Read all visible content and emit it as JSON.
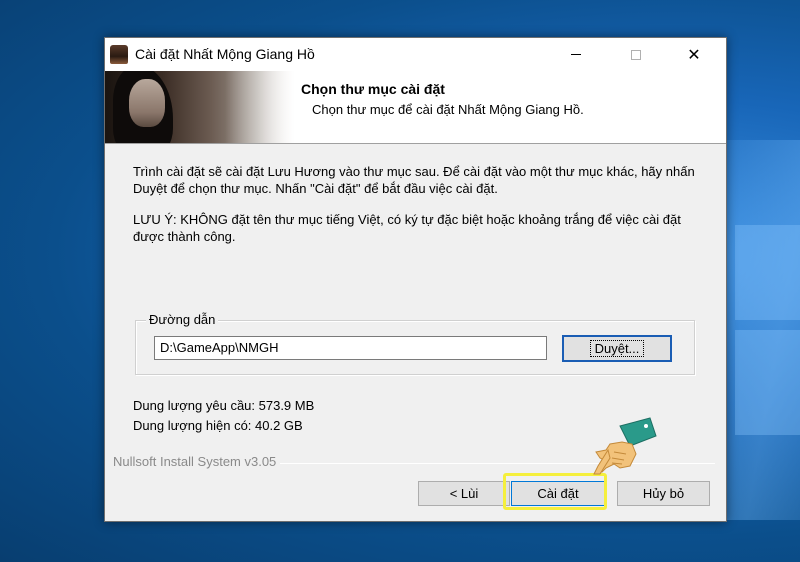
{
  "window": {
    "title": "Cài đặt Nhất Mộng Giang Hồ",
    "minimize_glyph": "",
    "close_glyph": "✕"
  },
  "header": {
    "title": "Chọn thư mục cài đặt",
    "subtitle": "Chọn thư mục để cài đặt Nhất Mộng Giang Hồ."
  },
  "body": {
    "paragraph1": "Trình cài đặt sẽ cài đặt Lưu Hương vào thư mục sau. Để cài đặt vào một thư mục khác, hãy nhấn Duyệt để chọn thư mục. Nhấn \"Cài đặt\" để bắt đầu việc cài đặt.",
    "paragraph2": "LƯU Ý: KHÔNG đặt tên thư mục tiếng Việt, có ký tự đặc biệt hoặc khoảng trắng để việc cài đặt được thành công.",
    "path_group_label": "Đường dẫn",
    "path_value": "D:\\GameApp\\NMGH",
    "browse_label": "Duyệt...",
    "space_required": "Dung lượng yêu cầu: 573.9 MB",
    "space_available": "Dung lượng hiện có: 40.2 GB"
  },
  "footer": {
    "branding": "Nullsoft Install System v3.05",
    "back_label": "< Lùi",
    "install_label": "Cài đặt",
    "cancel_label": "Hủy bỏ"
  },
  "colors": {
    "accent": "#0078d7",
    "highlight": "#f5ef3c",
    "desktop": "#1866b8"
  }
}
